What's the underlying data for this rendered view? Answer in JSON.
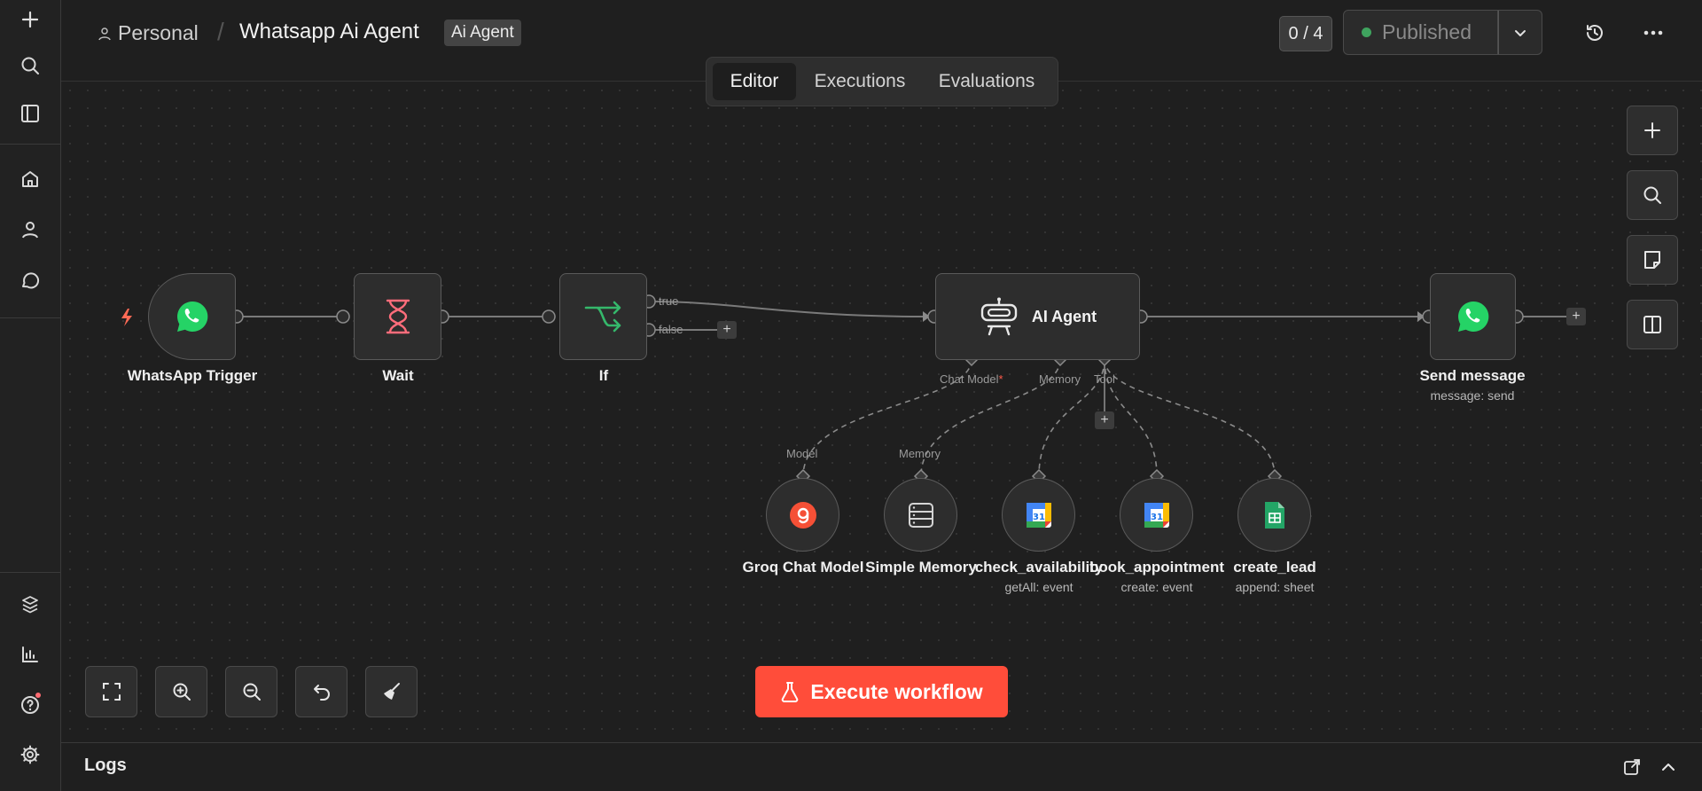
{
  "header": {
    "crumb_owner": "Personal",
    "crumb_separator": "/",
    "workflow_name": "Whatsapp Ai Agent",
    "workflow_tag": "Ai Agent",
    "counter": "0 / 4",
    "publish_label": "Published",
    "publish_status_color": "#3fa35e"
  },
  "tabs": [
    {
      "label": "Editor",
      "active": true
    },
    {
      "label": "Executions",
      "active": false
    },
    {
      "label": "Evaluations",
      "active": false
    }
  ],
  "nodes": {
    "whatsapp_trigger": {
      "label": "WhatsApp Trigger"
    },
    "wait": {
      "label": "Wait"
    },
    "if": {
      "label": "If",
      "outputs": [
        "true",
        "false"
      ]
    },
    "ai_agent": {
      "label": "AI Agent",
      "ports": [
        "Chat Model",
        "Memory",
        "Tool"
      ],
      "required_mark": "*"
    },
    "send_message": {
      "label": "Send message",
      "subtitle": "message: send"
    },
    "groq": {
      "label": "Groq Chat Model",
      "port": "Model"
    },
    "memory": {
      "label": "Simple Memory",
      "port": "Memory"
    },
    "check_availability": {
      "label": "check_availability",
      "subtitle": "getAll: event"
    },
    "book_appointment": {
      "label": "book_appointment",
      "subtitle": "create: event"
    },
    "create_lead": {
      "label": "create_lead",
      "subtitle": "append: sheet"
    }
  },
  "execute_button": "Execute workflow",
  "logs": {
    "title": "Logs"
  },
  "colors": {
    "accent": "#ff4d3a",
    "whatsapp": "#25d366",
    "wait_icon": "#ff6d7b",
    "if_icon": "#35b86b",
    "groq": "#f55036",
    "sheets": "#23a566"
  }
}
